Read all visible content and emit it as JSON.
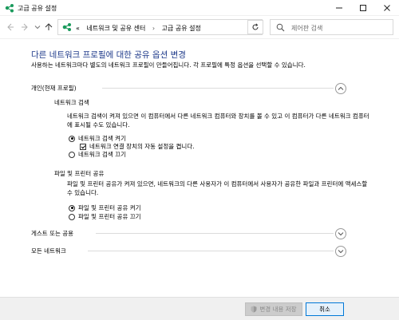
{
  "window": {
    "title": "고급 공유 설정"
  },
  "nav": {
    "breadcrumb_overflow": "«",
    "crumbs": [
      "네트워크 및 공유 센터",
      "고급 공유 설정"
    ],
    "separator": "›",
    "search_placeholder": "제어판 검색"
  },
  "main": {
    "title": "다른 네트워크 프로필에 대한 공유 옵션 변경",
    "description": "사용하는 네트워크마다 별도의 네트워크 프로필이 만들어집니다. 각 프로필에 특정 옵션을 선택할 수 있습니다."
  },
  "private": {
    "header": "개인(현재 프로필)",
    "discovery": {
      "heading": "네트워크 검색",
      "text": "네트워크 검색이 켜져 있으면 이 컴퓨터에서 다른 네트워크 컴퓨터와 장치를 볼 수 있고 이 컴퓨터가 다른 네트워크 컴퓨터에 표시될 수도 있습니다.",
      "on_label": "네트워크 검색 켜기",
      "auto_setup_label": "네트워크 연결 장치의 자동 설정을 켭니다.",
      "off_label": "네트워크 검색 끄기",
      "on_selected": true,
      "auto_setup_checked": true
    },
    "sharing": {
      "heading": "파일 및 프린터 공유",
      "text": "파일 및 프린터 공유가 켜져 있으면, 네트워크의 다른 사용자가 이 컴퓨터에서 사용자가 공유한 파일과 프린터에 액세스할 수 있습니다.",
      "on_label": "파일 및 프린터 공유 켜기",
      "off_label": "파일 및 프린터 공유 끄기",
      "on_selected": true
    }
  },
  "sections": {
    "guest_public": "게스트 또는 공용",
    "all_networks": "모든 네트워크"
  },
  "footer": {
    "save_label": "변경 내용 저장",
    "cancel_label": "취소"
  },
  "colors": {
    "title_blue": "#1e3a8a",
    "accent": "#0078d7"
  },
  "icons": {
    "app": "network-sharing-icon",
    "back": "arrow-left-icon",
    "forward": "arrow-right-icon",
    "up": "arrow-up-icon",
    "refresh": "refresh-icon",
    "search": "search-icon",
    "save": "uac-shield-icon"
  }
}
